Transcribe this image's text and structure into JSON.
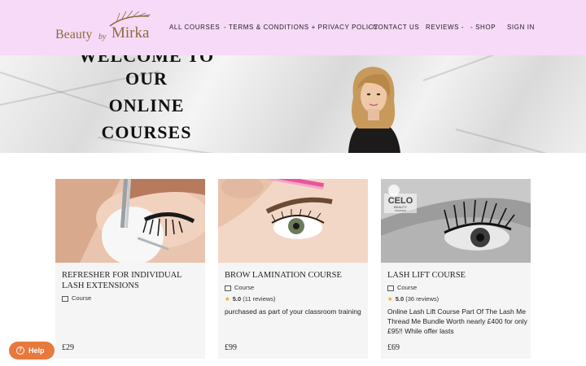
{
  "brand": {
    "part1": "Beauty",
    "part2": "by",
    "part3": "Mirka"
  },
  "nav": {
    "items": [
      {
        "label": "ALL COURSES"
      },
      {
        "label": "- TERMS & CONDITIONS + PRIVACY POLICY"
      },
      {
        "label": "- CONTACT US"
      },
      {
        "label": "REVIEWS -"
      },
      {
        "label": "- SHOP"
      },
      {
        "label": "SIGN IN"
      }
    ]
  },
  "hero": {
    "lines": [
      "WELCOME TO",
      "OUR",
      "ONLINE",
      "COURSES"
    ]
  },
  "courses": [
    {
      "title": "REFRESHER FOR INDIVIDUAL LASH EXTENSIONS",
      "type": "Course",
      "rating": "",
      "reviews": "",
      "description": "",
      "price": "£29"
    },
    {
      "title": "BROW LAMINATION COURSE",
      "type": "Course",
      "rating": "5.0",
      "reviews": "(11 reviews)",
      "description": "purchased as part of your classroom training",
      "price": "£99"
    },
    {
      "title": "LASH LIFT COURSE",
      "type": "Course",
      "rating": "5.0",
      "reviews": "(36 reviews)",
      "description": "Online Lash Lift Course Part Of The Lash Me Thread Me Bundle Worth nearly £400 for only £95!! While offer lasts",
      "price": "£69"
    }
  ],
  "course_badge": {
    "line1": "CELO",
    "line2": "BEAUTY",
    "line3": "TRAINING"
  },
  "help": {
    "label": "Help",
    "icon": "?"
  },
  "colors": {
    "header_bg": "#f7d9f8",
    "logo_gold": "#8a6d3e",
    "help_bg": "#e8793c",
    "star": "#f0a81c"
  }
}
